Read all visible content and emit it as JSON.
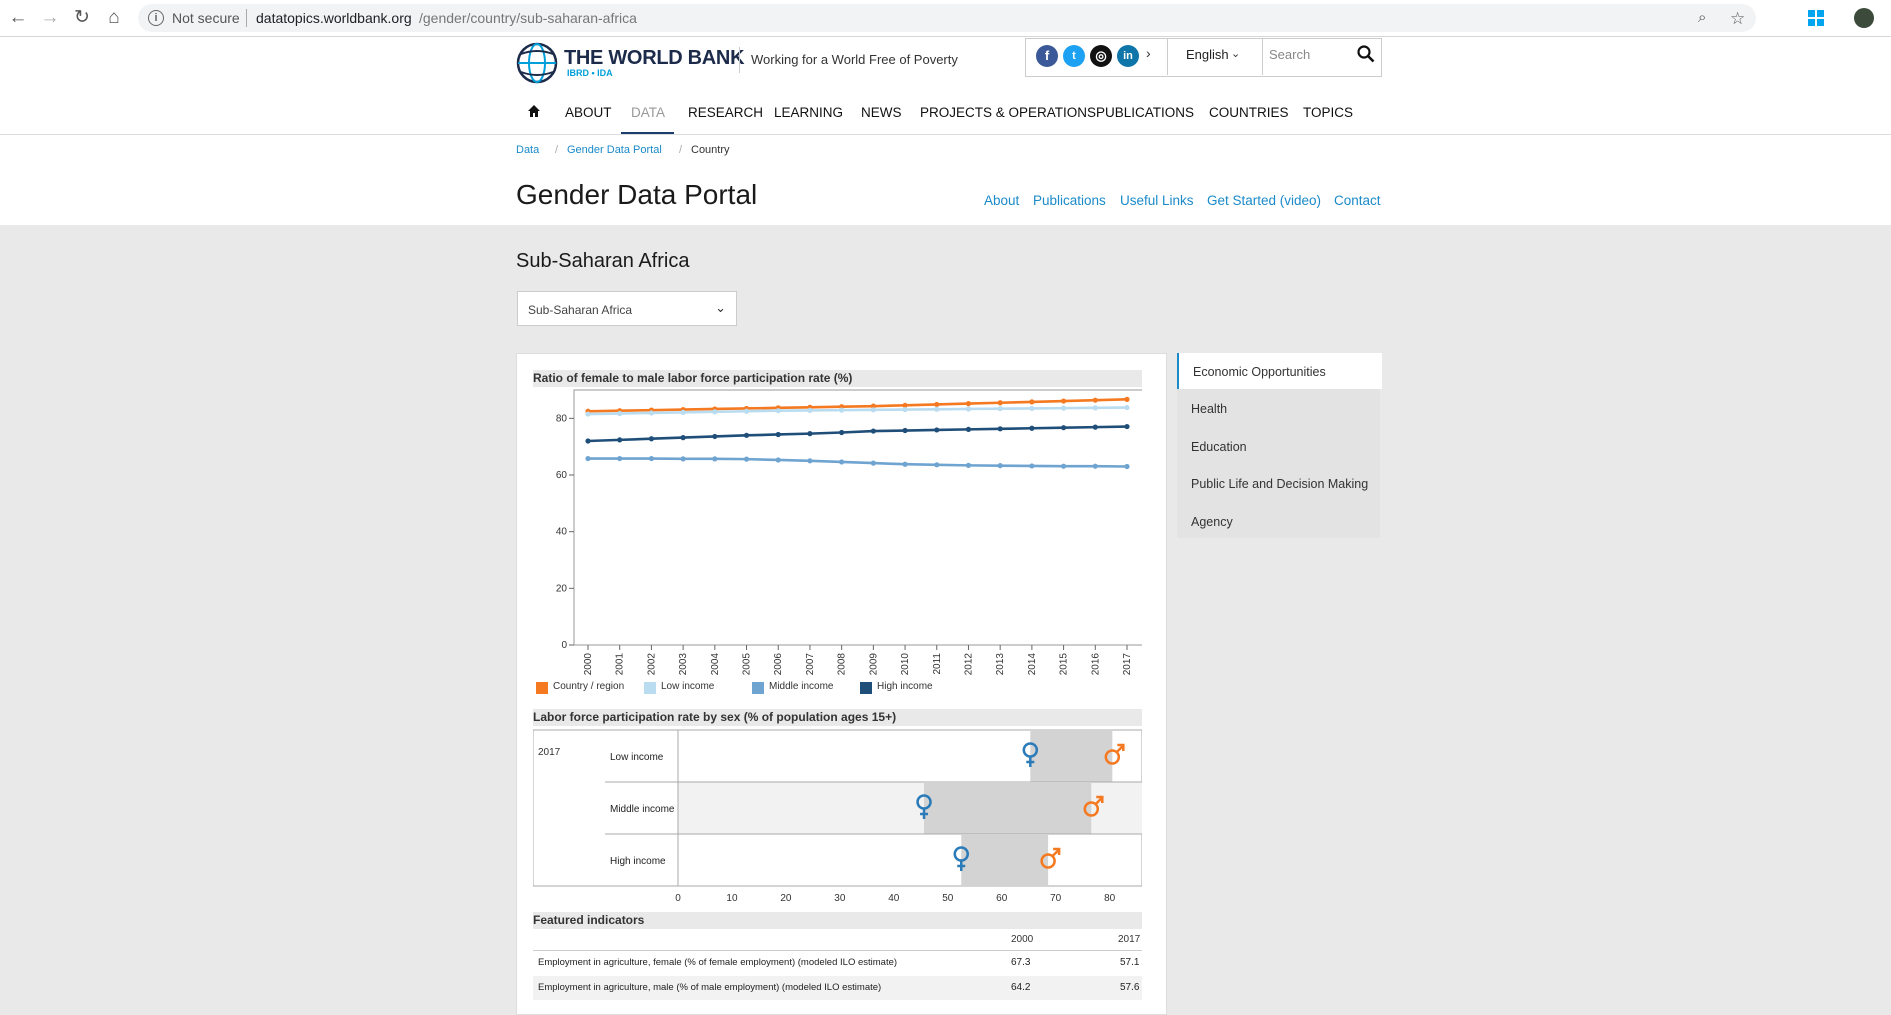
{
  "browser": {
    "security_label": "Not secure",
    "url_host": "datatopics.worldbank.org",
    "url_path": "/gender/country/sub-saharan-africa"
  },
  "header": {
    "brand_name": "THE WORLD BANK",
    "brand_sub": "IBRD • IDA",
    "tagline": "Working for a World Free of Poverty",
    "language": "English",
    "search_placeholder": "Search",
    "social": [
      "f",
      "t",
      "◎",
      "in"
    ]
  },
  "nav": {
    "items": [
      "ABOUT",
      "DATA",
      "RESEARCH",
      "LEARNING",
      "NEWS",
      "PROJECTS & OPERATIONS",
      "PUBLICATIONS",
      "COUNTRIES",
      "TOPICS"
    ],
    "active": "DATA"
  },
  "breadcrumb": [
    "Data",
    "Gender Data Portal",
    "Country"
  ],
  "portal": {
    "title": "Gender Data Portal",
    "links": [
      "About",
      "Publications",
      "Useful Links",
      "Get Started (video)",
      "Contact"
    ]
  },
  "region": {
    "title": "Sub-Saharan Africa",
    "selected": "Sub-Saharan Africa"
  },
  "side_menu": [
    "Economic Opportunities",
    "Health",
    "Education",
    "Public Life and Decision Making",
    "Agency"
  ],
  "chart_data": [
    {
      "type": "line",
      "title": "Ratio of female to male labor force participation rate (%)",
      "x": [
        2000,
        2001,
        2002,
        2003,
        2004,
        2005,
        2006,
        2007,
        2008,
        2009,
        2010,
        2011,
        2012,
        2013,
        2014,
        2015,
        2016,
        2017
      ],
      "ylim": [
        0,
        90
      ],
      "yticks": [
        0,
        20,
        40,
        60,
        80
      ],
      "series": [
        {
          "name": "Country / region",
          "color": "#f47920",
          "values": [
            82.5,
            82.7,
            82.9,
            83.1,
            83.3,
            83.5,
            83.7,
            83.9,
            84.1,
            84.3,
            84.6,
            84.9,
            85.2,
            85.5,
            85.8,
            86.1,
            86.4,
            86.7
          ]
        },
        {
          "name": "Low income",
          "color": "#b9dcf0",
          "values": [
            81.5,
            81.7,
            81.9,
            82.1,
            82.3,
            82.5,
            82.7,
            82.8,
            82.9,
            83.0,
            83.1,
            83.2,
            83.3,
            83.4,
            83.5,
            83.6,
            83.7,
            83.8
          ]
        },
        {
          "name": "Middle income",
          "color": "#6fa4d1",
          "values": [
            65.8,
            65.8,
            65.8,
            65.7,
            65.7,
            65.6,
            65.3,
            65.0,
            64.6,
            64.2,
            63.8,
            63.6,
            63.4,
            63.3,
            63.2,
            63.1,
            63.1,
            63.0
          ]
        },
        {
          "name": "High income",
          "color": "#1f4e79",
          "values": [
            72.0,
            72.4,
            72.8,
            73.2,
            73.6,
            74.0,
            74.3,
            74.6,
            75.0,
            75.5,
            75.7,
            75.9,
            76.1,
            76.3,
            76.5,
            76.7,
            76.9,
            77.1
          ]
        }
      ]
    },
    {
      "type": "dumbbell",
      "title": "Labor force participation rate by sex (% of population ages 15+)",
      "year": "2017",
      "categories": [
        "Low income",
        "Middle income",
        "High income"
      ],
      "female": [
        65.3,
        45.6,
        52.5
      ],
      "male": [
        80.5,
        76.6,
        68.6
      ],
      "xticks": [
        0,
        10,
        20,
        30,
        40,
        50,
        60,
        70,
        80
      ],
      "xlim": [
        0,
        86
      ]
    },
    {
      "type": "table",
      "title": "Featured indicators",
      "columns": [
        "",
        "2000",
        "2017"
      ],
      "rows": [
        [
          "Employment in agriculture, female (% of female employment) (modeled ILO estimate)",
          "67.3",
          "57.1"
        ],
        [
          "Employment in agriculture, male (% of male employment) (modeled ILO estimate)",
          "64.2",
          "57.6"
        ]
      ]
    }
  ]
}
